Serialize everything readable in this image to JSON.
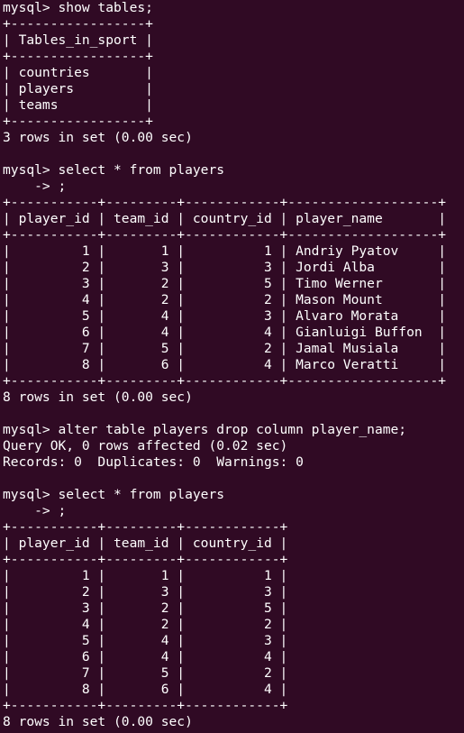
{
  "colors": {
    "background": "#300a24",
    "foreground": "#ffffff"
  },
  "terminal": {
    "lines": [
      "mysql> show tables;",
      "+-----------------+",
      "| Tables_in_sport |",
      "+-----------------+",
      "| countries       |",
      "| players         |",
      "| teams           |",
      "+-----------------+",
      "3 rows in set (0.00 sec)",
      "",
      "mysql> select * from players",
      "    -> ;",
      "+-----------+---------+------------+-------------------+",
      "| player_id | team_id | country_id | player_name       |",
      "+-----------+---------+------------+-------------------+",
      "|         1 |       1 |          1 | Andriy Pyatov     |",
      "|         2 |       3 |          3 | Jordi Alba        |",
      "|         3 |       2 |          5 | Timo Werner       |",
      "|         4 |       2 |          2 | Mason Mount       |",
      "|         5 |       4 |          3 | Alvaro Morata     |",
      "|         6 |       4 |          4 | Gianluigi Buffon  |",
      "|         7 |       5 |          2 | Jamal Musiala     |",
      "|         8 |       6 |          4 | Marco Veratti     |",
      "+-----------+---------+------------+-------------------+",
      "8 rows in set (0.00 sec)",
      "",
      "mysql> alter table players drop column player_name;",
      "Query OK, 0 rows affected (0.02 sec)",
      "Records: 0  Duplicates: 0  Warnings: 0",
      "",
      "mysql> select * from players",
      "    -> ;",
      "+-----------+---------+------------+",
      "| player_id | team_id | country_id |",
      "+-----------+---------+------------+",
      "|         1 |       1 |          1 |",
      "|         2 |       3 |          3 |",
      "|         3 |       2 |          5 |",
      "|         4 |       2 |          2 |",
      "|         5 |       4 |          3 |",
      "|         6 |       4 |          4 |",
      "|         7 |       5 |          2 |",
      "|         8 |       6 |          4 |",
      "+-----------+---------+------------+",
      "8 rows in set (0.00 sec)"
    ]
  }
}
